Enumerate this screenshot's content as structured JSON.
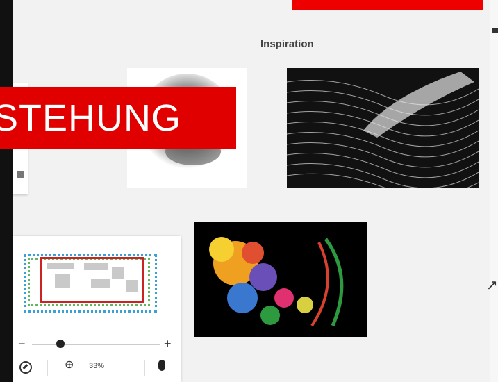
{
  "board": {
    "section_title": "Inspiration"
  },
  "banner": {
    "text": "STEHUNG",
    "color": "#e00000"
  },
  "minimap": {
    "zoom_level": "33%",
    "slider_position": 0.22,
    "icons": [
      "compass-icon",
      "zoom-in-icon",
      "mouse-icon"
    ]
  },
  "colors": {
    "accent_red": "#ee0000",
    "viewport_blue": "#3aa0d8",
    "viewport_green": "#5fb85f",
    "frame_red": "#cc2222"
  }
}
